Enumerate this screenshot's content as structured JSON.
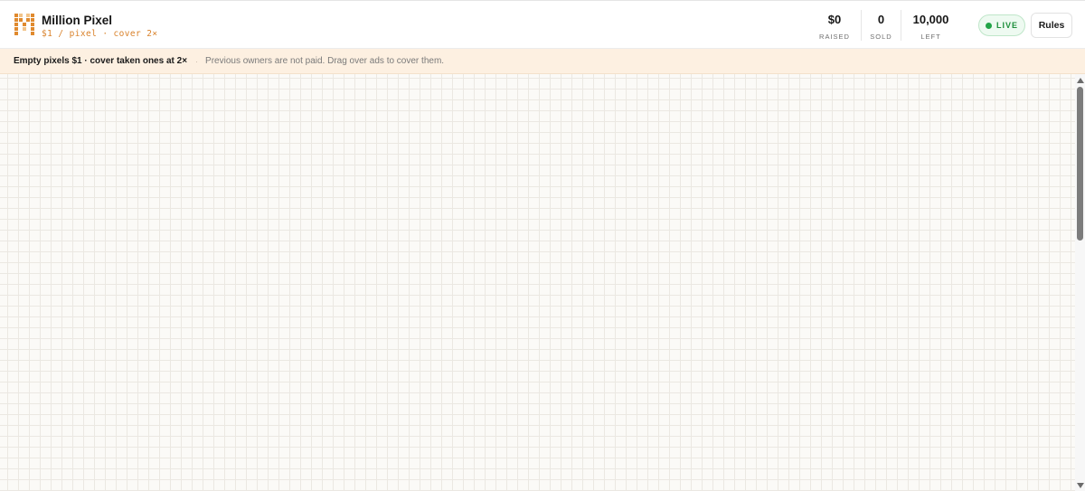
{
  "brand": {
    "title": "Million Pixel",
    "subtitle": "$1 / pixel · cover 2×",
    "logo_icon": "pixel-m-logo-icon",
    "accent_color": "#d9822b"
  },
  "stats": {
    "raised": {
      "value": "$0",
      "label": "RAISED"
    },
    "sold": {
      "value": "0",
      "label": "SOLD"
    },
    "left": {
      "value": "10,000",
      "label": "LEFT"
    }
  },
  "status": {
    "label": "LIVE",
    "color": "#22a447"
  },
  "buttons": {
    "rules": "Rules"
  },
  "notice": {
    "primary": "Empty pixels $1 · cover taken ones at 2×",
    "separator": "·",
    "secondary": "Previous owners are not paid. Drag over ads to cover them."
  },
  "canvas": {
    "background_color": "#fbfaf7",
    "grid_line_color": "#ebe8e2"
  }
}
